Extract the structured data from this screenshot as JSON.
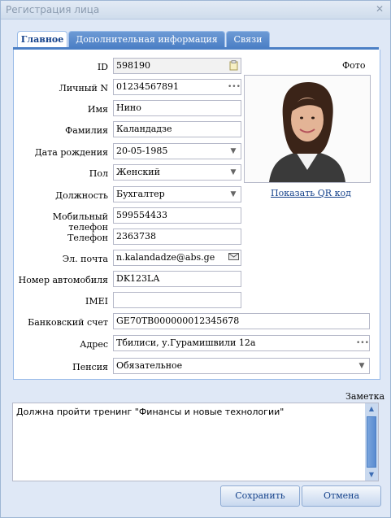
{
  "window": {
    "title": "Регистрация лица"
  },
  "tabs": [
    {
      "label": "Главное"
    },
    {
      "label": "Дополнительная информация"
    },
    {
      "label": "Связи"
    }
  ],
  "form": {
    "id": {
      "label": "ID",
      "value": "598190"
    },
    "personal_no": {
      "label": "Личный N",
      "value": "01234567891"
    },
    "first_name": {
      "label": "Имя",
      "value": "Нино"
    },
    "last_name": {
      "label": "Фамилия",
      "value": "Каландадзе"
    },
    "birth_date": {
      "label": "Дата рождения",
      "value": "20-05-1985"
    },
    "gender": {
      "label": "Пол",
      "value": "Женский"
    },
    "position": {
      "label": "Должность",
      "value": "Бухгалтер"
    },
    "mobile": {
      "label": "Мобильный телефон",
      "value": "599554433"
    },
    "phone": {
      "label": "Телефон",
      "value": "2363738"
    },
    "email": {
      "label": "Эл. почта",
      "value": "n.kalandadze@abs.ge"
    },
    "car_number": {
      "label": "Номер автомобиля",
      "value": "DK123LA"
    },
    "imei": {
      "label": "IMEI",
      "value": ""
    },
    "bank_account": {
      "label": "Банковский счет",
      "value": "GE70TB000000012345678"
    },
    "address": {
      "label": "Адрес",
      "value": "Тбилиси, у.Гурамишвили 12а"
    },
    "pension": {
      "label": "Пенсия",
      "value": "Обязательное"
    }
  },
  "photo": {
    "label": "Фото",
    "qr_link": "Показать QR код"
  },
  "notes": {
    "label": "Заметка",
    "value": "Должна пройти тренинг \"Финансы и новые технологии\""
  },
  "buttons": {
    "save": "Сохранить",
    "cancel": "Отмена"
  },
  "colors": {
    "accent": "#4b7fc5",
    "window_bg": "#dfe8f6",
    "link": "#15428b"
  },
  "icons": {
    "id_copy": "clipboard-icon",
    "more": "ellipsis-icon",
    "dropdown": "chevron-down-icon",
    "email": "envelope-icon",
    "close": "close-icon"
  }
}
